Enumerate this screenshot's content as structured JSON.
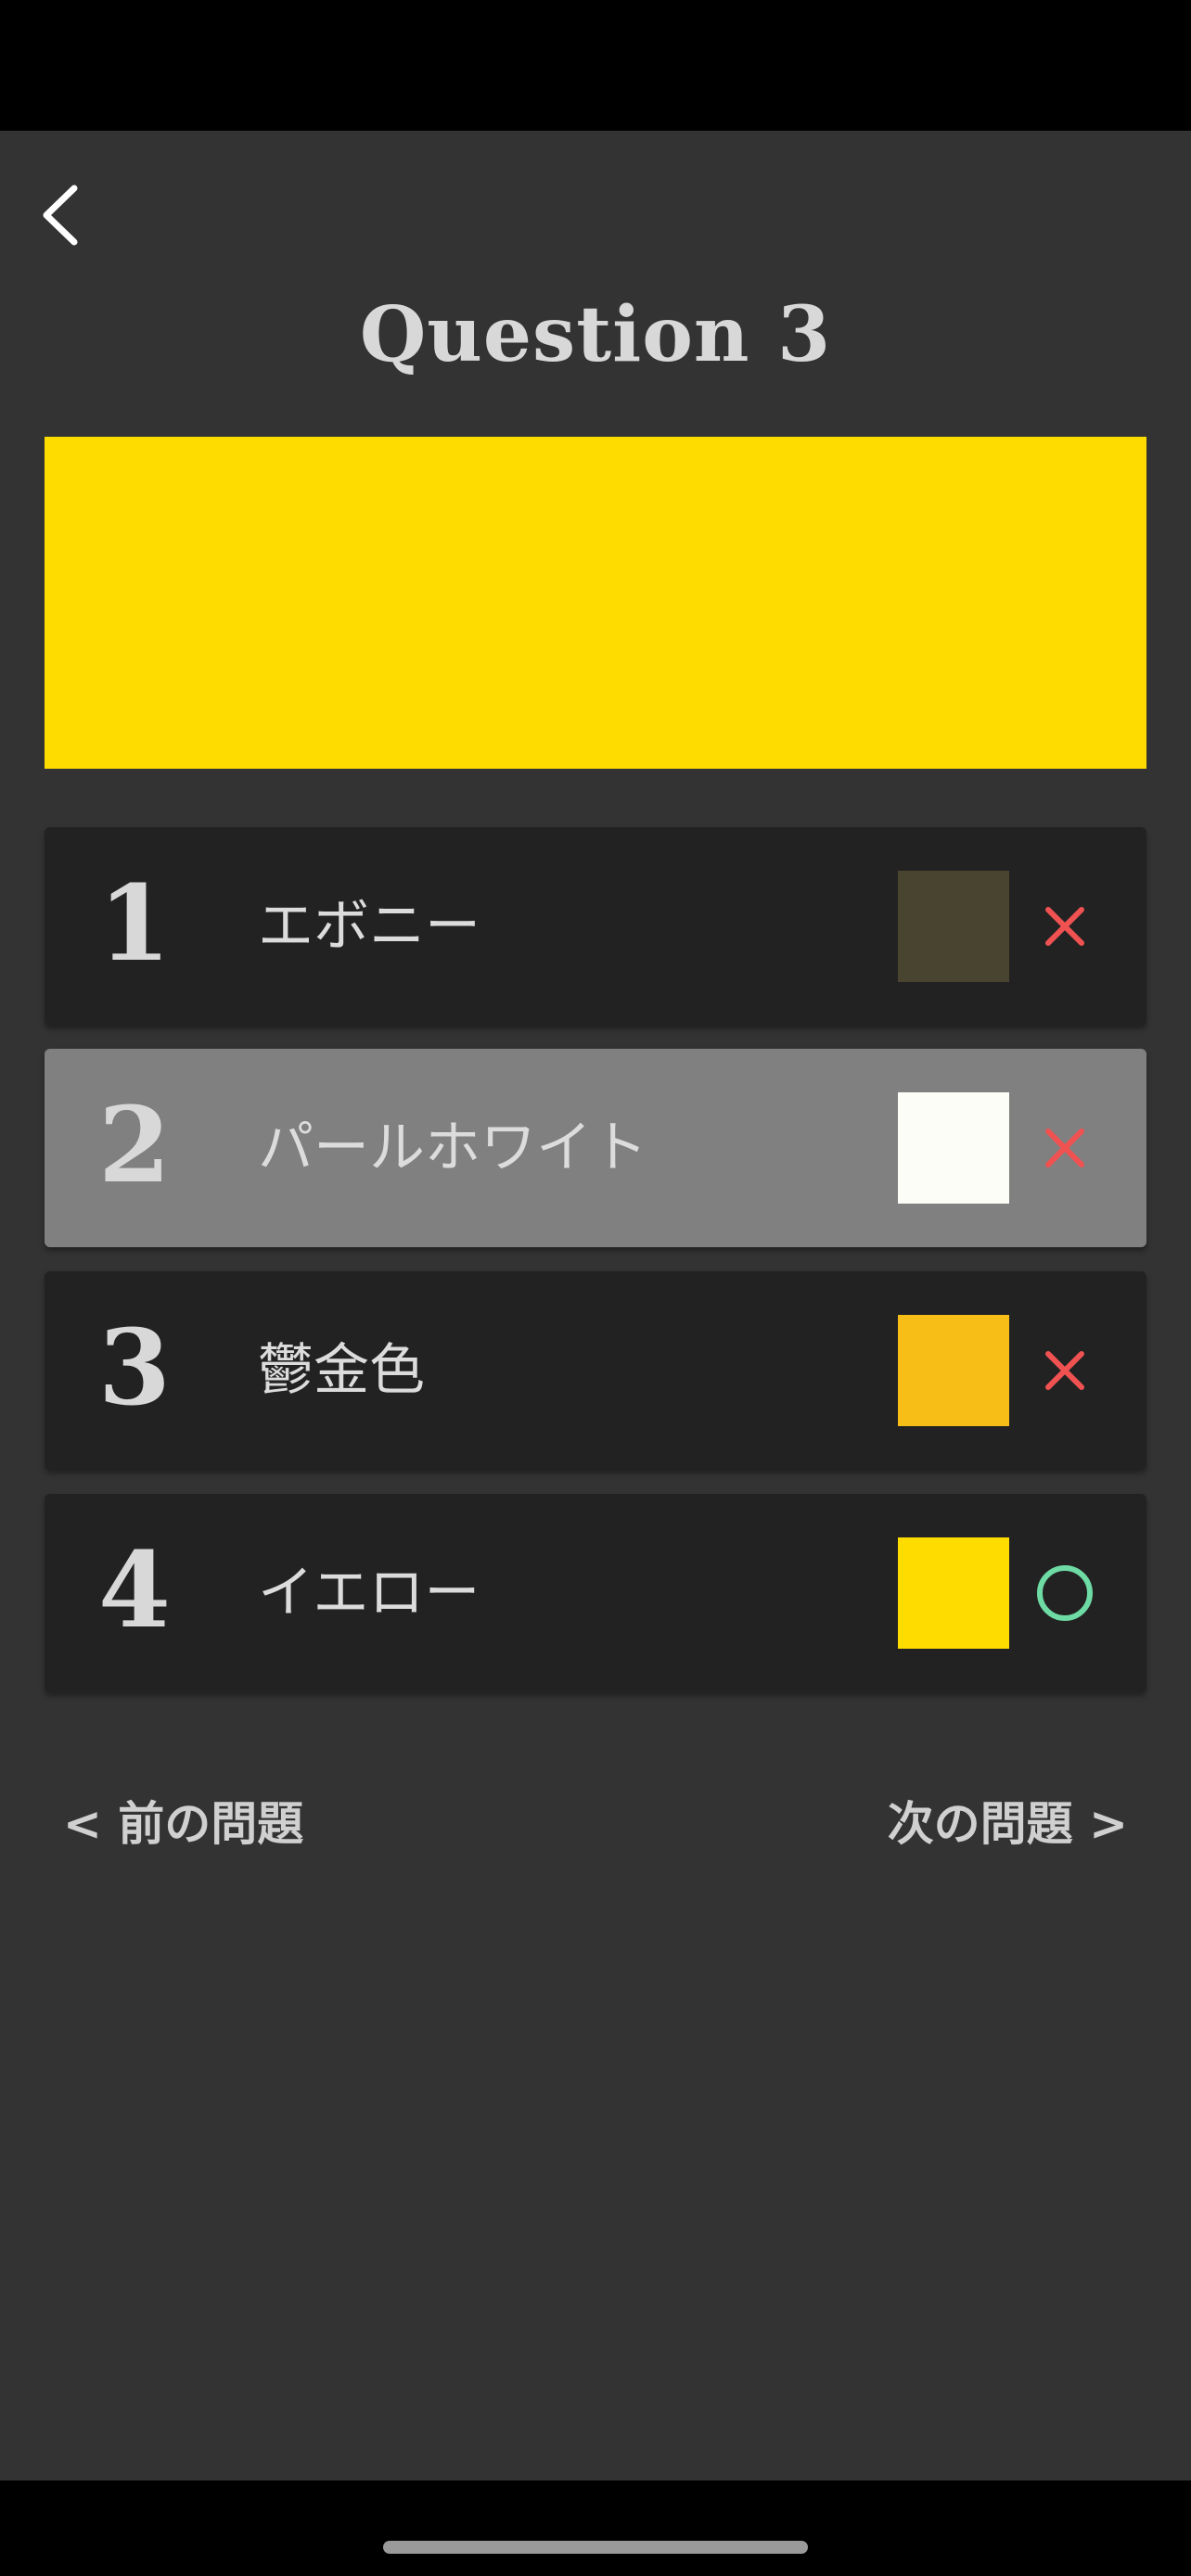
{
  "question": {
    "title": "Question 3",
    "target_color": "#FFDC00"
  },
  "options": [
    {
      "number": "1",
      "label": "エボニー",
      "swatch_color": "#48442F",
      "result": "incorrect",
      "mark_icon": "cross-icon",
      "mark_color": "#F05252"
    },
    {
      "number": "2",
      "label": "パールホワイト",
      "swatch_color": "#FDFDF8",
      "result": "incorrect",
      "mark_icon": "cross-icon",
      "mark_color": "#F05252",
      "selected": true
    },
    {
      "number": "3",
      "label": "鬱金色",
      "swatch_color": "#F8BE18",
      "result": "incorrect",
      "mark_icon": "cross-icon",
      "mark_color": "#F05252"
    },
    {
      "number": "4",
      "label": "イエロー",
      "swatch_color": "#FFDC00",
      "result": "correct",
      "mark_icon": "circle-icon",
      "mark_color": "#6EDBA4"
    }
  ],
  "navigation": {
    "prev_label": "< 前の問題",
    "next_label": "次の問題 >"
  },
  "colors": {
    "background": "#333333",
    "card_dark": "#222222",
    "card_selected": "#808080",
    "incorrect": "#F05252",
    "correct": "#6EDBA4"
  }
}
